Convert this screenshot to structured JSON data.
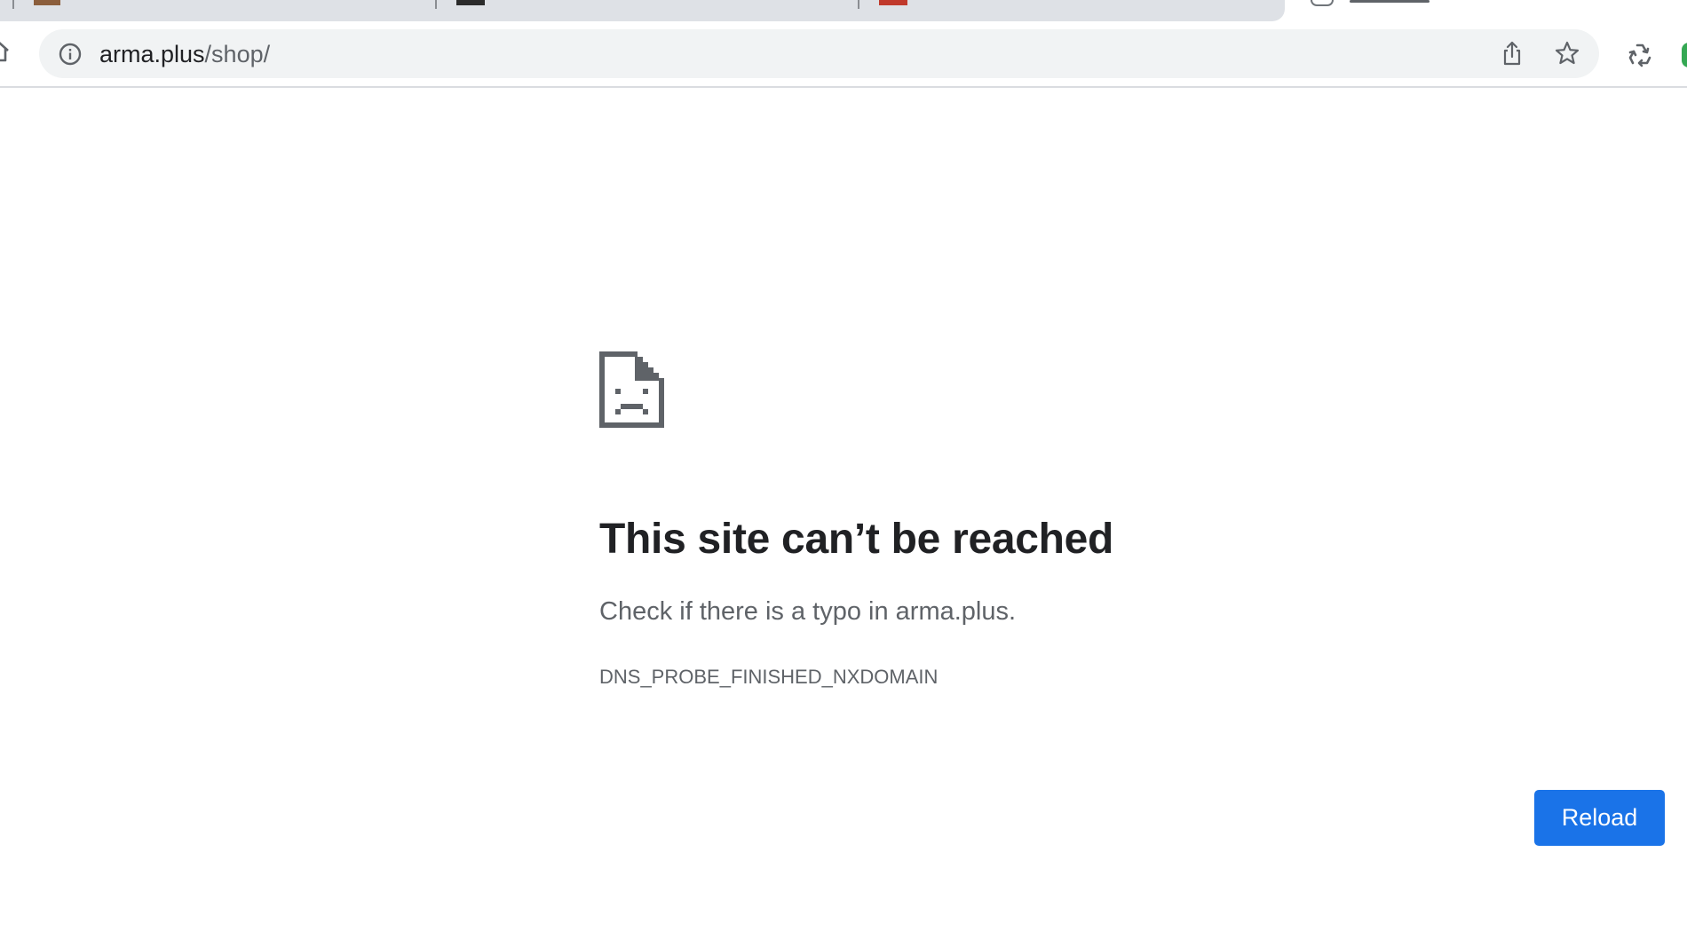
{
  "browser": {
    "omnibox": {
      "host": "arma.plus",
      "path": "/shop/"
    },
    "icons": {
      "home": "home-icon",
      "info": "info-icon",
      "share": "share-icon",
      "bookmark": "star-icon",
      "extension": "recycle-icon",
      "profile": "avatar"
    }
  },
  "error_page": {
    "icon": "sad-page-icon",
    "title": "This site can’t be reached",
    "suggestion": "Check if there is a typo in arma.plus.",
    "error_code": "DNS_PROBE_FINISHED_NXDOMAIN",
    "reload_label": "Reload"
  },
  "colors": {
    "accent": "#1a73e8",
    "title_text": "#202124",
    "secondary_text": "#5f6368",
    "omnibox_bg": "#f1f3f4",
    "tabstrip_bg": "#dee1e6",
    "profile_green": "#34a853"
  }
}
